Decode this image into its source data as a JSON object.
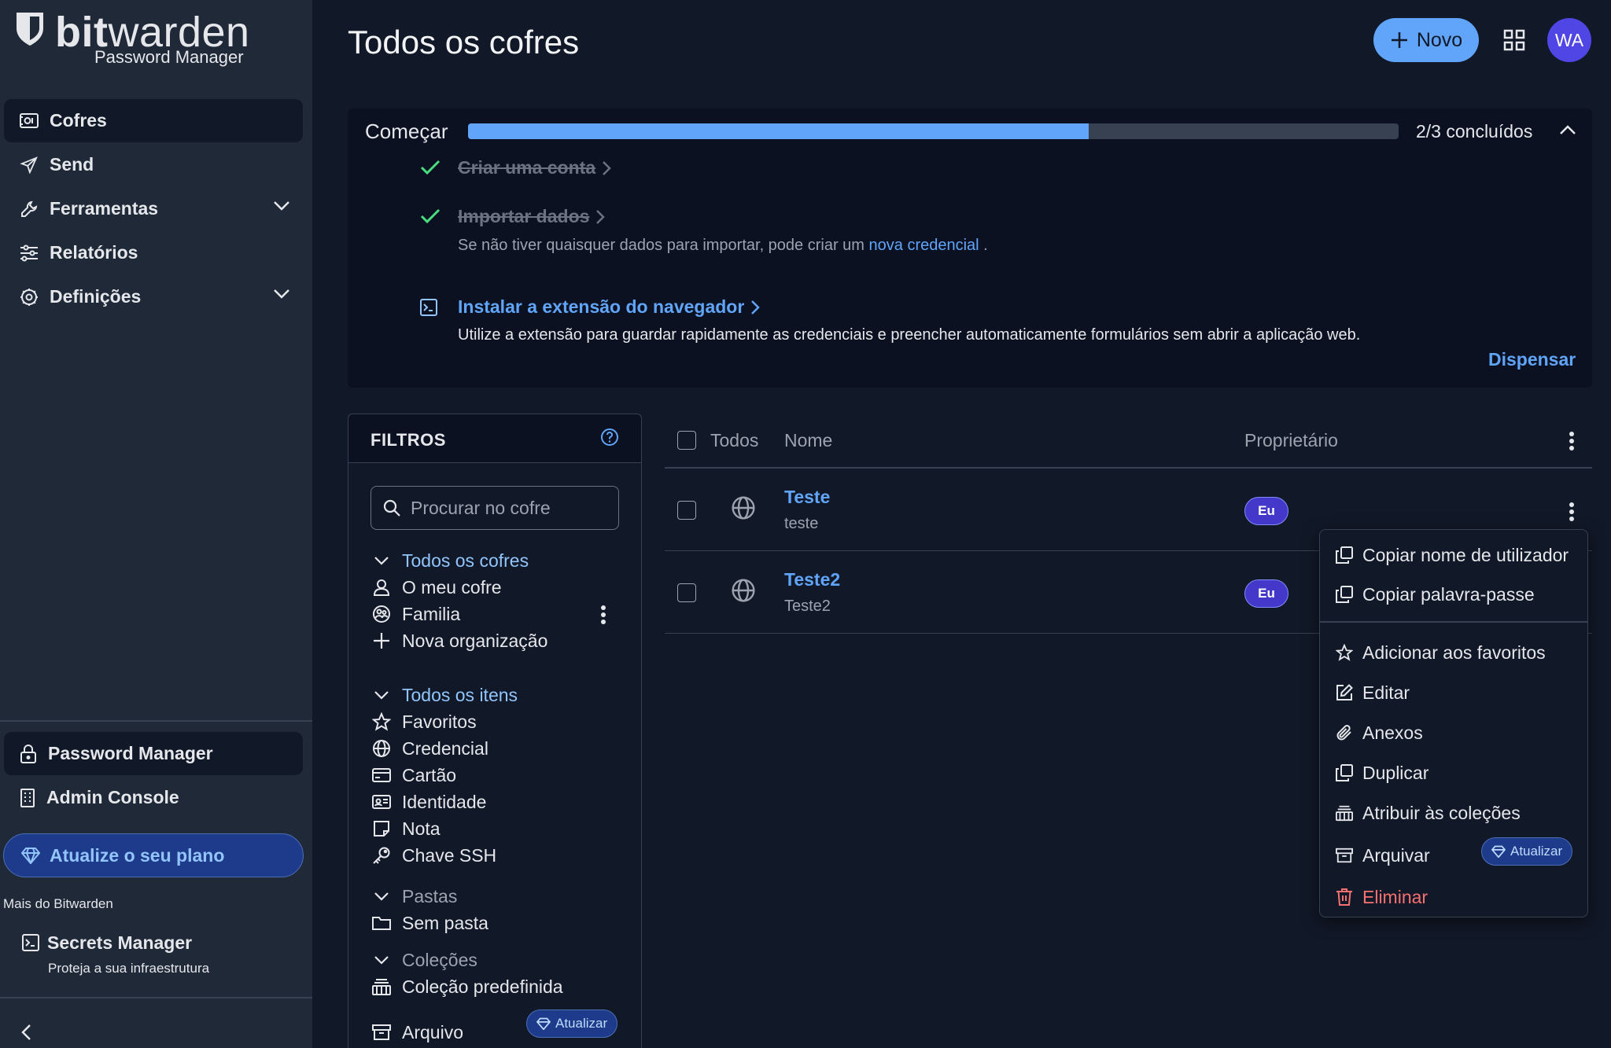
{
  "brand": {
    "word_bold": "bit",
    "word_light": "warden",
    "product": "Password Manager"
  },
  "sidebar": {
    "items": [
      {
        "label": "Cofres"
      },
      {
        "label": "Send"
      },
      {
        "label": "Ferramentas"
      },
      {
        "label": "Relatórios"
      },
      {
        "label": "Definições"
      }
    ],
    "apps": [
      {
        "label": "Password Manager"
      },
      {
        "label": "Admin Console"
      }
    ],
    "upgrade_label": "Atualize o seu plano",
    "more_label": "Mais do Bitwarden",
    "secrets": {
      "title": "Secrets Manager",
      "subtitle": "Proteja a sua infraestrutura"
    }
  },
  "header": {
    "title": "Todos os cofres",
    "new_label": "Novo",
    "avatar_initials": "WA"
  },
  "getting_started": {
    "title": "Começar",
    "progress_fraction": 0.667,
    "progress_text": "2/3 concluídos",
    "tasks": [
      {
        "label": "Criar uma conta"
      },
      {
        "label": "Importar dados",
        "desc_before": "Se não tiver quaisquer dados para importar, pode criar um",
        "desc_link": "nova credencial",
        "desc_after": "."
      },
      {
        "label": "Instalar a extensão do navegador",
        "desc": "Utilize a extensão para guardar rapidamente as credenciais e preencher automaticamente formulários sem abrir a aplicação web."
      }
    ],
    "dismiss_label": "Dispensar"
  },
  "filters": {
    "title": "FILTROS",
    "search_placeholder": "Procurar no cofre",
    "vaults_header": "Todos os cofres",
    "vaults": [
      "O meu cofre",
      "Familia",
      "Nova organização"
    ],
    "items_header": "Todos os itens",
    "item_types": [
      "Favoritos",
      "Credencial",
      "Cartão",
      "Identidade",
      "Nota",
      "Chave SSH"
    ],
    "folders_header": "Pastas",
    "folders": [
      "Sem pasta"
    ],
    "collections_header": "Coleções",
    "collections": [
      "Coleção predefinida"
    ],
    "archive_label": "Arquivo",
    "archive_badge": "Atualizar"
  },
  "table": {
    "col_all": "Todos",
    "col_name": "Nome",
    "col_owner": "Proprietário",
    "rows": [
      {
        "name": "Teste",
        "subtitle": "teste",
        "owner": "Eu"
      },
      {
        "name": "Teste2",
        "subtitle": "Teste2",
        "owner": "Eu"
      }
    ]
  },
  "context_menu": {
    "items": [
      "Copiar nome de utilizador",
      "Copiar palavra-passe",
      "Adicionar aos favoritos",
      "Editar",
      "Anexos",
      "Duplicar",
      "Atribuir às coleções",
      "Arquivar",
      "Eliminar"
    ],
    "archive_badge": "Atualizar"
  },
  "colors": {
    "accent": "#60a5fa",
    "sidebar_bg": "#1f2937",
    "page_bg": "#111827",
    "danger": "#f87171",
    "success": "#4ade80",
    "owner_badge": "#4338ca"
  }
}
